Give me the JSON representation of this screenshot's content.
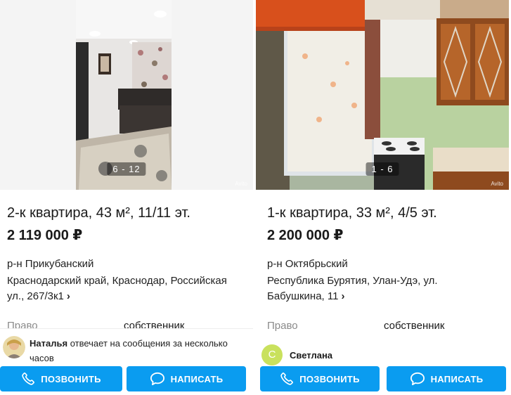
{
  "listings": [
    {
      "photo_counter": "6 - 12",
      "watermark": "Avito",
      "title": "2-к квартира, 43 м², 11/11 эт.",
      "price": "2 119 000 ₽",
      "district": "р-н Прикубанский",
      "address": "Краснодарский край, Краснодар, Российская ул., 267/3к1",
      "param_label": "Право",
      "param_value": "собственник",
      "contact_name": "Наталья",
      "contact_note": "отвечает на сообщения за несколько часов",
      "call_label": "ПОЗВОНИТЬ",
      "write_label": "НАПИСАТЬ"
    },
    {
      "photo_counter": "1 - 6",
      "watermark": "Avito",
      "title": "1-к квартира, 33 м², 4/5 эт.",
      "price": "2 200 000 ₽",
      "district": "р-н Октябрьский",
      "address": "Республика Бурятия, Улан-Удэ, ул. Бабушкина, 11",
      "param_label": "Право",
      "param_value": "собственник",
      "contact_name": "Светлана",
      "contact_initial": "С",
      "call_label": "ПОЗВОНИТЬ",
      "write_label": "НАПИСАТЬ"
    }
  ],
  "colors": {
    "button": "#0a9cf0",
    "avatar_bg": "#c9e15d"
  },
  "icons": {
    "call": "phone-icon",
    "write": "chat-bubble-icon",
    "next": "chevron-right-icon"
  }
}
